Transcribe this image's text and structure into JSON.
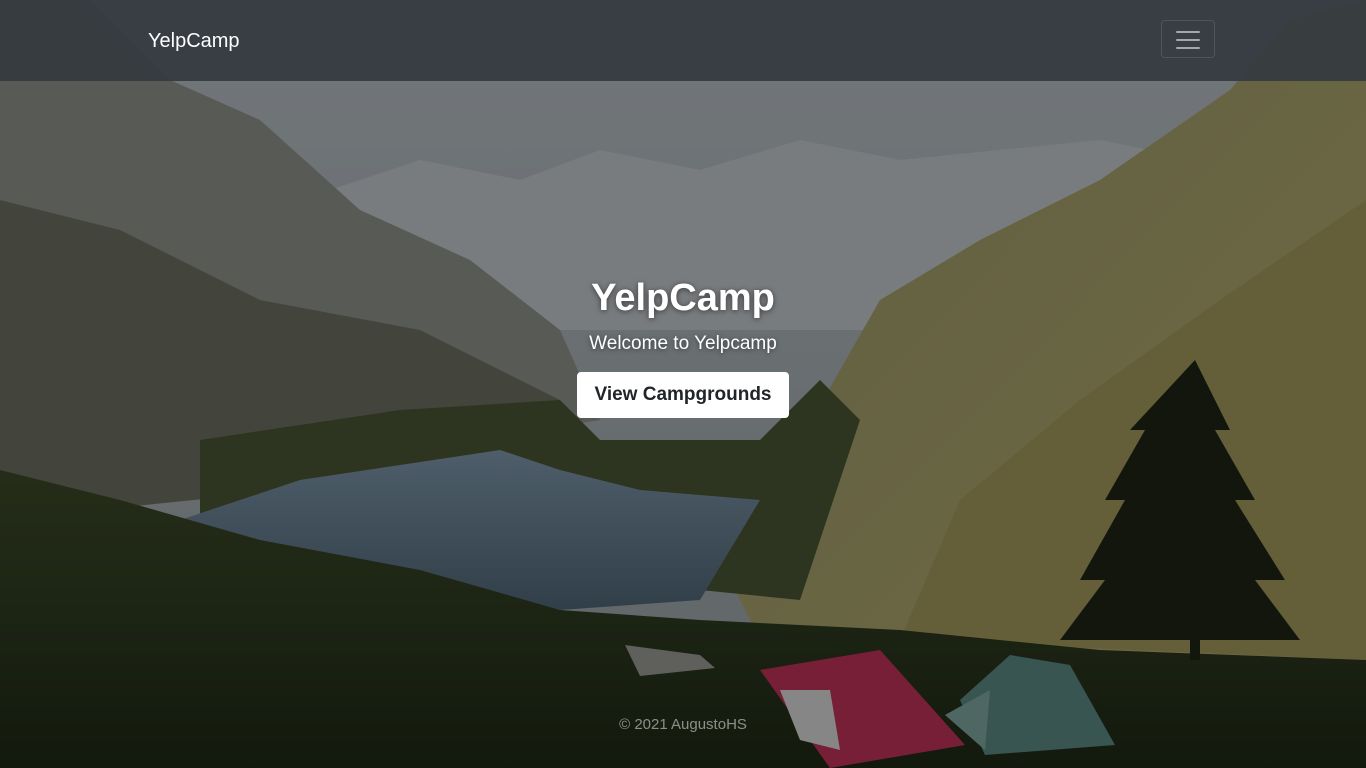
{
  "navbar": {
    "brand": "YelpCamp",
    "toggler_icon": "hamburger-menu-icon"
  },
  "hero": {
    "title": "YelpCamp",
    "subtitle": "Welcome to Yelpcamp",
    "cta_label": "View Campgrounds"
  },
  "footer": {
    "copyright": "© 2021 AugustoHS"
  },
  "colors": {
    "navbar_bg": "#343a40",
    "button_bg": "#ffffff",
    "button_text": "#212529",
    "text": "#ffffff"
  }
}
